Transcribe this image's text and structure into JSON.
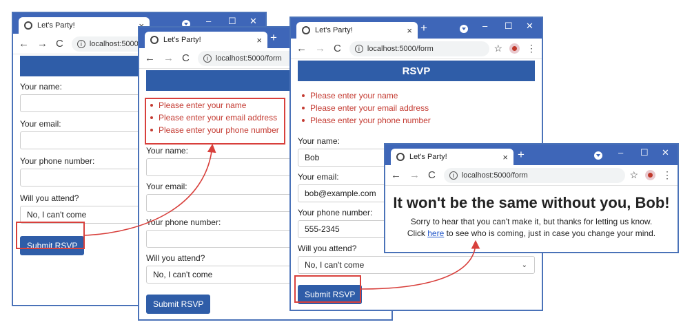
{
  "browser": {
    "tab_title": "Let's Party!",
    "tab_close": "×",
    "new_tab": "+",
    "minimize": "–",
    "maximize": "☐",
    "close": "✕",
    "back": "←",
    "forward": "→",
    "reload": "C",
    "info": "i",
    "star": "☆",
    "menu": "⋮",
    "url_form": "localhost:5000/form",
    "url_form_truncated": "localhost:5000/for"
  },
  "form": {
    "heading": "RSVP",
    "name_label": "Your name:",
    "email_label": "Your email:",
    "phone_label": "Your phone number:",
    "attend_label": "Will you attend?",
    "attend_value": "No, I can't come",
    "submit": "Submit RSVP",
    "chevron": "⌄"
  },
  "errors": [
    "Please enter your name",
    "Please enter your email address",
    "Please enter your phone number"
  ],
  "filled": {
    "name": "Bob",
    "email": "bob@example.com",
    "phone": "555-2345"
  },
  "thanks": {
    "heading": "It won't be the same without you, Bob!",
    "line1": "Sorry to hear that you can't make it, but thanks for letting us know.",
    "click": "Click",
    "here": "here",
    "line2_rest": "to see who is coming, just in case you change your mind."
  },
  "colors": {
    "titlebar": "#3e66b8",
    "accent": "#2f5da8",
    "error": "#c43a31",
    "highlight": "#d8403c"
  }
}
